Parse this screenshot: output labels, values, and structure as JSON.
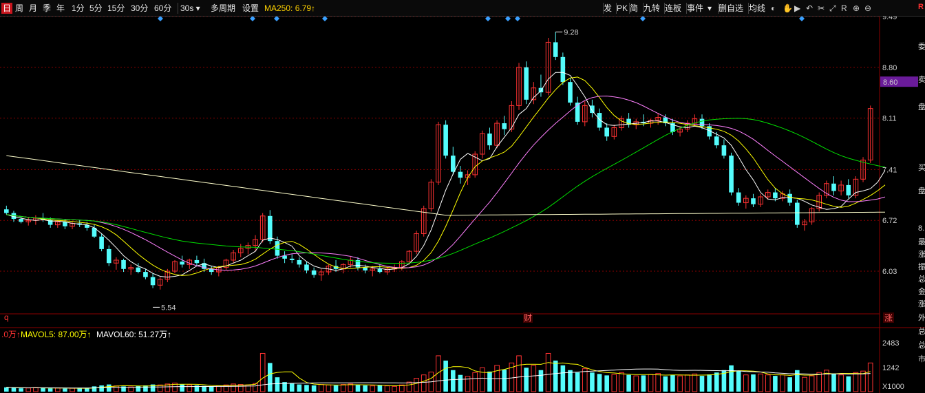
{
  "toolbar": {
    "periods": [
      "日",
      "周",
      "月",
      "季",
      "年",
      "1分",
      "5分",
      "15分",
      "30分",
      "60分"
    ],
    "active_period": "日",
    "interval_select": "30s",
    "multi_period": "多周期",
    "settings": "设置",
    "ma250_label": "MA250: 6.79↑",
    "right_items": [
      "发",
      "PK",
      "简",
      "九转",
      "连板",
      "事件",
      "删自选",
      "均线"
    ]
  },
  "price_axis": {
    "ticks": [
      "9.49",
      "8.80",
      "8.11",
      "7.41",
      "6.72",
      "6.03"
    ],
    "current_price": "8.60",
    "current_price_bg": "#6a1b9a"
  },
  "annotations": {
    "high_label": "9.28",
    "low_label": "5.54",
    "left_marker": "q",
    "finance_marker": "财",
    "rise_marker": "涨"
  },
  "volume": {
    "legend_vol": ".0万↑",
    "legend_mavol5": "MAVOL5: 87.00万↑",
    "legend_mavol60": "MAVOL60: 51.27万↑",
    "ticks": [
      "2483",
      "1242"
    ],
    "unit": "X1000"
  },
  "side_panel": {
    "letters": [
      "委",
      "卖",
      "盘",
      "买",
      "盘",
      "8.",
      "最",
      "涨",
      "振",
      "总",
      "金",
      "涨",
      "外",
      "总",
      "总",
      "市"
    ],
    "top_tag": "R"
  },
  "colors": {
    "up": "#ff3232",
    "down": "#54fcfc",
    "ma5": "#ffffff",
    "ma10": "#ffff00",
    "ma20": "#ff80ff",
    "ma60": "#00e000",
    "ma250": "#ffffcc",
    "grid": "#8b0000"
  },
  "chart_data": {
    "type": "candlestick",
    "y_range": [
      5.4,
      9.6
    ],
    "candles": [
      [
        6.87,
        6.92,
        6.8,
        6.82
      ],
      [
        6.82,
        6.85,
        6.7,
        6.74
      ],
      [
        6.74,
        6.78,
        6.68,
        6.7
      ],
      [
        6.7,
        6.76,
        6.65,
        6.72
      ],
      [
        6.72,
        6.79,
        6.66,
        6.75
      ],
      [
        6.75,
        6.82,
        6.7,
        6.73
      ],
      [
        6.73,
        6.76,
        6.62,
        6.66
      ],
      [
        6.66,
        6.72,
        6.62,
        6.7
      ],
      [
        6.7,
        6.74,
        6.6,
        6.64
      ],
      [
        6.64,
        6.7,
        6.6,
        6.68
      ],
      [
        6.68,
        6.73,
        6.63,
        6.66
      ],
      [
        6.66,
        6.7,
        6.58,
        6.62
      ],
      [
        6.62,
        6.66,
        6.48,
        6.5
      ],
      [
        6.5,
        6.54,
        6.3,
        6.33
      ],
      [
        6.33,
        6.38,
        6.1,
        6.14
      ],
      [
        6.14,
        6.22,
        6.05,
        6.18
      ],
      [
        6.18,
        6.2,
        6.02,
        6.06
      ],
      [
        6.06,
        6.12,
        5.98,
        6.08
      ],
      [
        6.08,
        6.14,
        6.0,
        6.02
      ],
      [
        6.02,
        6.06,
        5.92,
        5.95
      ],
      [
        5.95,
        6.0,
        5.8,
        5.84
      ],
      [
        5.84,
        5.95,
        5.78,
        5.92
      ],
      [
        5.92,
        6.06,
        5.88,
        6.03
      ],
      [
        6.03,
        6.18,
        6.0,
        6.16
      ],
      [
        6.16,
        6.24,
        6.08,
        6.12
      ],
      [
        6.12,
        6.2,
        6.06,
        6.18
      ],
      [
        6.18,
        6.24,
        6.1,
        6.14
      ],
      [
        6.14,
        6.2,
        6.02,
        6.06
      ],
      [
        6.06,
        6.1,
        5.98,
        6.02
      ],
      [
        6.02,
        6.1,
        5.96,
        6.08
      ],
      [
        6.08,
        6.2,
        6.04,
        6.18
      ],
      [
        6.18,
        6.32,
        6.14,
        6.28
      ],
      [
        6.28,
        6.4,
        6.22,
        6.34
      ],
      [
        6.34,
        6.42,
        6.26,
        6.38
      ],
      [
        6.38,
        6.52,
        6.3,
        6.46
      ],
      [
        6.46,
        6.82,
        6.42,
        6.78
      ],
      [
        6.78,
        6.86,
        6.4,
        6.44
      ],
      [
        6.44,
        6.5,
        6.2,
        6.24
      ],
      [
        6.24,
        6.3,
        6.14,
        6.2
      ],
      [
        6.2,
        6.26,
        6.14,
        6.18
      ],
      [
        6.18,
        6.22,
        6.08,
        6.12
      ],
      [
        6.12,
        6.16,
        6.0,
        6.04
      ],
      [
        6.04,
        6.08,
        5.94,
        5.98
      ],
      [
        5.98,
        6.06,
        5.9,
        6.02
      ],
      [
        6.02,
        6.12,
        5.98,
        6.1
      ],
      [
        6.1,
        6.18,
        6.02,
        6.06
      ],
      [
        6.06,
        6.14,
        6.0,
        6.12
      ],
      [
        6.12,
        6.22,
        6.08,
        6.18
      ],
      [
        6.18,
        6.22,
        6.04,
        6.08
      ],
      [
        6.08,
        6.12,
        6.0,
        6.04
      ],
      [
        6.04,
        6.1,
        5.96,
        6.06
      ],
      [
        6.06,
        6.12,
        6.0,
        6.02
      ],
      [
        6.02,
        6.08,
        5.98,
        6.06
      ],
      [
        6.06,
        6.12,
        6.02,
        6.08
      ],
      [
        6.08,
        6.18,
        6.04,
        6.16
      ],
      [
        6.16,
        6.32,
        6.12,
        6.3
      ],
      [
        6.3,
        6.58,
        6.26,
        6.54
      ],
      [
        6.54,
        6.92,
        6.5,
        6.88
      ],
      [
        6.88,
        7.28,
        6.84,
        7.24
      ],
      [
        7.24,
        8.06,
        7.2,
        8.02
      ],
      [
        8.02,
        8.08,
        7.56,
        7.6
      ],
      [
        7.6,
        7.72,
        7.34,
        7.38
      ],
      [
        7.38,
        7.46,
        7.22,
        7.3
      ],
      [
        7.3,
        7.4,
        7.2,
        7.34
      ],
      [
        7.34,
        7.66,
        7.3,
        7.62
      ],
      [
        7.62,
        7.94,
        7.56,
        7.9
      ],
      [
        7.9,
        7.98,
        7.68,
        7.74
      ],
      [
        7.74,
        8.08,
        7.7,
        8.04
      ],
      [
        8.04,
        8.14,
        7.88,
        7.96
      ],
      [
        7.96,
        8.34,
        7.92,
        8.28
      ],
      [
        8.28,
        8.86,
        8.22,
        8.8
      ],
      [
        8.8,
        8.88,
        8.3,
        8.36
      ],
      [
        8.36,
        8.6,
        8.3,
        8.52
      ],
      [
        8.52,
        8.7,
        8.4,
        8.46
      ],
      [
        8.46,
        9.2,
        8.42,
        9.14
      ],
      [
        9.14,
        9.28,
        8.9,
        8.94
      ],
      [
        8.94,
        9.0,
        8.56,
        8.6
      ],
      [
        8.6,
        8.66,
        8.28,
        8.32
      ],
      [
        8.32,
        8.4,
        8.02,
        8.06
      ],
      [
        8.06,
        8.34,
        8.0,
        8.28
      ],
      [
        8.28,
        8.36,
        8.12,
        8.18
      ],
      [
        8.18,
        8.24,
        7.94,
        7.98
      ],
      [
        7.98,
        8.04,
        7.8,
        7.86
      ],
      [
        7.86,
        8.02,
        7.82,
        7.98
      ],
      [
        7.98,
        8.14,
        7.94,
        8.1
      ],
      [
        8.1,
        8.18,
        7.98,
        8.02
      ],
      [
        8.02,
        8.1,
        7.96,
        8.06
      ],
      [
        8.06,
        8.16,
        8.0,
        8.04
      ],
      [
        8.04,
        8.1,
        7.98,
        8.08
      ],
      [
        8.08,
        8.18,
        8.02,
        8.12
      ],
      [
        8.12,
        8.16,
        8.0,
        8.04
      ],
      [
        8.04,
        8.1,
        7.88,
        7.92
      ],
      [
        7.92,
        8.0,
        7.86,
        7.96
      ],
      [
        7.96,
        8.08,
        7.92,
        8.04
      ],
      [
        8.04,
        8.16,
        8.0,
        8.1
      ],
      [
        8.1,
        8.16,
        7.96,
        8.0
      ],
      [
        8.0,
        8.04,
        7.82,
        7.86
      ],
      [
        7.86,
        7.92,
        7.7,
        7.74
      ],
      [
        7.74,
        7.82,
        7.56,
        7.6
      ],
      [
        7.6,
        7.64,
        7.06,
        7.1
      ],
      [
        7.1,
        7.16,
        6.92,
        6.96
      ],
      [
        6.96,
        7.06,
        6.88,
        7.02
      ],
      [
        7.02,
        7.08,
        6.9,
        6.94
      ],
      [
        6.94,
        7.08,
        6.9,
        7.04
      ],
      [
        7.04,
        7.14,
        7.0,
        7.1
      ],
      [
        7.1,
        7.16,
        6.98,
        7.02
      ],
      [
        7.02,
        7.12,
        6.98,
        7.08
      ],
      [
        7.08,
        7.14,
        6.92,
        6.96
      ],
      [
        6.96,
        7.0,
        6.62,
        6.66
      ],
      [
        6.66,
        6.74,
        6.58,
        6.7
      ],
      [
        6.7,
        6.9,
        6.66,
        6.88
      ],
      [
        6.88,
        7.1,
        6.84,
        7.06
      ],
      [
        7.06,
        7.26,
        7.02,
        7.22
      ],
      [
        7.22,
        7.32,
        7.06,
        7.12
      ],
      [
        7.12,
        7.26,
        7.06,
        7.2
      ],
      [
        7.2,
        7.28,
        7.02,
        7.06
      ],
      [
        7.06,
        7.32,
        7.02,
        7.28
      ],
      [
        7.28,
        7.58,
        7.24,
        7.54
      ],
      [
        7.54,
        8.28,
        7.5,
        8.24
      ]
    ],
    "volume": [
      18,
      16,
      14,
      15,
      17,
      16,
      14,
      15,
      13,
      14,
      15,
      13,
      22,
      26,
      30,
      24,
      22,
      20,
      24,
      26,
      30,
      28,
      32,
      36,
      30,
      28,
      26,
      24,
      22,
      24,
      28,
      32,
      30,
      28,
      34,
      160,
      120,
      60,
      40,
      34,
      30,
      28,
      26,
      30,
      28,
      26,
      30,
      32,
      28,
      26,
      24,
      26,
      24,
      22,
      28,
      40,
      56,
      70,
      82,
      150,
      130,
      90,
      70,
      64,
      80,
      100,
      84,
      110,
      92,
      120,
      150,
      100,
      110,
      90,
      160,
      130,
      110,
      90,
      80,
      96,
      80,
      74,
      68,
      72,
      80,
      70,
      66,
      68,
      72,
      76,
      64,
      70,
      66,
      70,
      74,
      66,
      72,
      80,
      90,
      110,
      86,
      70,
      72,
      74,
      70,
      66,
      70,
      60,
      90,
      60,
      66,
      80,
      90,
      76,
      70,
      64,
      80,
      86,
      120
    ],
    "ma_lines": {
      "ma5": [
        6.8,
        6.77,
        6.75,
        6.73,
        6.72,
        6.73,
        6.71,
        6.71,
        6.7,
        6.68,
        6.67,
        6.66,
        6.62,
        6.54,
        6.45,
        6.35,
        6.24,
        6.16,
        6.1,
        6.06,
        6.0,
        5.96,
        5.95,
        5.96,
        5.98,
        6.04,
        6.1,
        6.13,
        6.1,
        6.08,
        6.1,
        6.14,
        6.18,
        6.24,
        6.3,
        6.45,
        6.48,
        6.46,
        6.42,
        6.37,
        6.24,
        6.16,
        6.1,
        6.07,
        6.06,
        6.04,
        6.06,
        6.1,
        6.11,
        6.1,
        6.08,
        6.07,
        6.05,
        6.06,
        6.08,
        6.13,
        6.23,
        6.38,
        6.59,
        6.86,
        7.13,
        7.35,
        7.55,
        7.63,
        7.58,
        7.53,
        7.56,
        7.72,
        7.85,
        7.98,
        8.16,
        8.24,
        8.39,
        8.48,
        8.64,
        8.73,
        8.73,
        8.69,
        8.55,
        8.4,
        8.21,
        8.09,
        8.02,
        8.01,
        8.02,
        8.03,
        8.04,
        8.05,
        8.07,
        8.07,
        8.05,
        8.02,
        7.99,
        7.98,
        8.0,
        7.98,
        7.94,
        7.89,
        7.84,
        7.74,
        7.58,
        7.41,
        7.27,
        7.1,
        7.01,
        7.0,
        7.03,
        7.03,
        7.02,
        6.98,
        6.93,
        6.9,
        6.87,
        6.88,
        6.91,
        7.01,
        7.1,
        7.12,
        7.15,
        7.24,
        7.4
      ]
    }
  }
}
